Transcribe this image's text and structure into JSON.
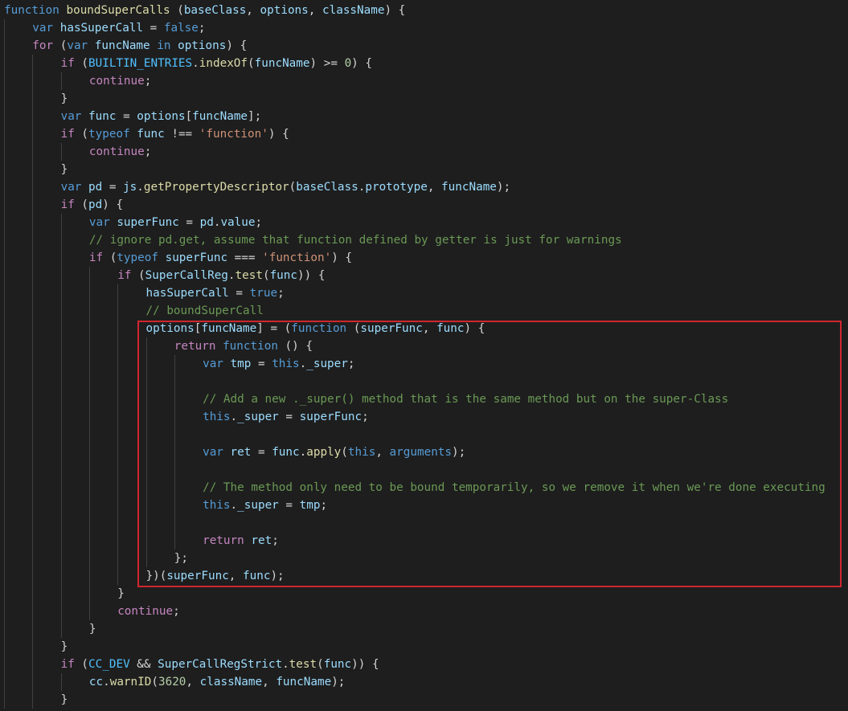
{
  "theme": {
    "background": "#1e1e1e",
    "highlight_border": "#d0262f",
    "token_colors": {
      "keyword": "#569cd6",
      "control": "#c586c0",
      "function": "#dcdcaa",
      "variable": "#9cdcfe",
      "string": "#ce9178",
      "comment": "#6a9955",
      "number": "#b5cea8",
      "constant": "#4fc1ff",
      "punct": "#d4d4d4"
    }
  },
  "code": {
    "highlighted_range": {
      "first_line": 19,
      "last_line": 33
    },
    "lines": [
      {
        "indent": 0,
        "tokens": [
          [
            "keyword",
            "function"
          ],
          [
            "punct",
            " "
          ],
          [
            "function",
            "boundSuperCalls"
          ],
          [
            "punct",
            " ("
          ],
          [
            "variable",
            "baseClass"
          ],
          [
            "punct",
            ", "
          ],
          [
            "variable",
            "options"
          ],
          [
            "punct",
            ", "
          ],
          [
            "variable",
            "className"
          ],
          [
            "punct",
            ") {"
          ]
        ]
      },
      {
        "indent": 1,
        "tokens": [
          [
            "keyword",
            "var"
          ],
          [
            "punct",
            " "
          ],
          [
            "variable",
            "hasSuperCall"
          ],
          [
            "punct",
            " = "
          ],
          [
            "keyword",
            "false"
          ],
          [
            "punct",
            ";"
          ]
        ]
      },
      {
        "indent": 1,
        "tokens": [
          [
            "control",
            "for"
          ],
          [
            "punct",
            " ("
          ],
          [
            "keyword",
            "var"
          ],
          [
            "punct",
            " "
          ],
          [
            "variable",
            "funcName"
          ],
          [
            "punct",
            " "
          ],
          [
            "keyword",
            "in"
          ],
          [
            "punct",
            " "
          ],
          [
            "variable",
            "options"
          ],
          [
            "punct",
            ") {"
          ]
        ]
      },
      {
        "indent": 2,
        "tokens": [
          [
            "control",
            "if"
          ],
          [
            "punct",
            " ("
          ],
          [
            "constant",
            "BUILTIN_ENTRIES"
          ],
          [
            "punct",
            "."
          ],
          [
            "function",
            "indexOf"
          ],
          [
            "punct",
            "("
          ],
          [
            "variable",
            "funcName"
          ],
          [
            "punct",
            ") >= "
          ],
          [
            "number",
            "0"
          ],
          [
            "punct",
            ") {"
          ]
        ]
      },
      {
        "indent": 3,
        "tokens": [
          [
            "control",
            "continue"
          ],
          [
            "punct",
            ";"
          ]
        ]
      },
      {
        "indent": 2,
        "tokens": [
          [
            "punct",
            "}"
          ]
        ]
      },
      {
        "indent": 2,
        "tokens": [
          [
            "keyword",
            "var"
          ],
          [
            "punct",
            " "
          ],
          [
            "variable",
            "func"
          ],
          [
            "punct",
            " = "
          ],
          [
            "variable",
            "options"
          ],
          [
            "punct",
            "["
          ],
          [
            "variable",
            "funcName"
          ],
          [
            "punct",
            "];"
          ]
        ]
      },
      {
        "indent": 2,
        "tokens": [
          [
            "control",
            "if"
          ],
          [
            "punct",
            " ("
          ],
          [
            "keyword",
            "typeof"
          ],
          [
            "punct",
            " "
          ],
          [
            "variable",
            "func"
          ],
          [
            "punct",
            " !== "
          ],
          [
            "string",
            "'function'"
          ],
          [
            "punct",
            ") {"
          ]
        ]
      },
      {
        "indent": 3,
        "tokens": [
          [
            "control",
            "continue"
          ],
          [
            "punct",
            ";"
          ]
        ]
      },
      {
        "indent": 2,
        "tokens": [
          [
            "punct",
            "}"
          ]
        ]
      },
      {
        "indent": 2,
        "tokens": [
          [
            "keyword",
            "var"
          ],
          [
            "punct",
            " "
          ],
          [
            "variable",
            "pd"
          ],
          [
            "punct",
            " = "
          ],
          [
            "variable",
            "js"
          ],
          [
            "punct",
            "."
          ],
          [
            "function",
            "getPropertyDescriptor"
          ],
          [
            "punct",
            "("
          ],
          [
            "variable",
            "baseClass"
          ],
          [
            "punct",
            "."
          ],
          [
            "variable",
            "prototype"
          ],
          [
            "punct",
            ", "
          ],
          [
            "variable",
            "funcName"
          ],
          [
            "punct",
            ");"
          ]
        ]
      },
      {
        "indent": 2,
        "tokens": [
          [
            "control",
            "if"
          ],
          [
            "punct",
            " ("
          ],
          [
            "variable",
            "pd"
          ],
          [
            "punct",
            ") {"
          ]
        ]
      },
      {
        "indent": 3,
        "tokens": [
          [
            "keyword",
            "var"
          ],
          [
            "punct",
            " "
          ],
          [
            "variable",
            "superFunc"
          ],
          [
            "punct",
            " = "
          ],
          [
            "variable",
            "pd"
          ],
          [
            "punct",
            "."
          ],
          [
            "variable",
            "value"
          ],
          [
            "punct",
            ";"
          ]
        ]
      },
      {
        "indent": 3,
        "tokens": [
          [
            "comment",
            "// ignore pd.get, assume that function defined by getter is just for warnings"
          ]
        ]
      },
      {
        "indent": 3,
        "tokens": [
          [
            "control",
            "if"
          ],
          [
            "punct",
            " ("
          ],
          [
            "keyword",
            "typeof"
          ],
          [
            "punct",
            " "
          ],
          [
            "variable",
            "superFunc"
          ],
          [
            "punct",
            " === "
          ],
          [
            "string",
            "'function'"
          ],
          [
            "punct",
            ") {"
          ]
        ]
      },
      {
        "indent": 4,
        "tokens": [
          [
            "control",
            "if"
          ],
          [
            "punct",
            " ("
          ],
          [
            "variable",
            "SuperCallReg"
          ],
          [
            "punct",
            "."
          ],
          [
            "function",
            "test"
          ],
          [
            "punct",
            "("
          ],
          [
            "variable",
            "func"
          ],
          [
            "punct",
            ")) {"
          ]
        ]
      },
      {
        "indent": 5,
        "tokens": [
          [
            "variable",
            "hasSuperCall"
          ],
          [
            "punct",
            " = "
          ],
          [
            "keyword",
            "true"
          ],
          [
            "punct",
            ";"
          ]
        ]
      },
      {
        "indent": 5,
        "tokens": [
          [
            "comment",
            "// boundSuperCall"
          ]
        ]
      },
      {
        "indent": 5,
        "tokens": [
          [
            "variable",
            "options"
          ],
          [
            "punct",
            "["
          ],
          [
            "variable",
            "funcName"
          ],
          [
            "punct",
            "] = ("
          ],
          [
            "keyword",
            "function"
          ],
          [
            "punct",
            " ("
          ],
          [
            "variable",
            "superFunc"
          ],
          [
            "punct",
            ", "
          ],
          [
            "variable",
            "func"
          ],
          [
            "punct",
            ") {"
          ]
        ]
      },
      {
        "indent": 6,
        "tokens": [
          [
            "control",
            "return"
          ],
          [
            "punct",
            " "
          ],
          [
            "keyword",
            "function"
          ],
          [
            "punct",
            " () {"
          ]
        ]
      },
      {
        "indent": 7,
        "tokens": [
          [
            "keyword",
            "var"
          ],
          [
            "punct",
            " "
          ],
          [
            "variable",
            "tmp"
          ],
          [
            "punct",
            " = "
          ],
          [
            "keyword",
            "this"
          ],
          [
            "punct",
            "."
          ],
          [
            "variable",
            "_super"
          ],
          [
            "punct",
            ";"
          ]
        ]
      },
      {
        "indent": 7,
        "tokens": []
      },
      {
        "indent": 7,
        "tokens": [
          [
            "comment",
            "// Add a new ._super() method that is the same method but on the super-Class"
          ]
        ]
      },
      {
        "indent": 7,
        "tokens": [
          [
            "keyword",
            "this"
          ],
          [
            "punct",
            "."
          ],
          [
            "variable",
            "_super"
          ],
          [
            "punct",
            " = "
          ],
          [
            "variable",
            "superFunc"
          ],
          [
            "punct",
            ";"
          ]
        ]
      },
      {
        "indent": 7,
        "tokens": []
      },
      {
        "indent": 7,
        "tokens": [
          [
            "keyword",
            "var"
          ],
          [
            "punct",
            " "
          ],
          [
            "variable",
            "ret"
          ],
          [
            "punct",
            " = "
          ],
          [
            "variable",
            "func"
          ],
          [
            "punct",
            "."
          ],
          [
            "function",
            "apply"
          ],
          [
            "punct",
            "("
          ],
          [
            "keyword",
            "this"
          ],
          [
            "punct",
            ", "
          ],
          [
            "keyword",
            "arguments"
          ],
          [
            "punct",
            ");"
          ]
        ]
      },
      {
        "indent": 7,
        "tokens": []
      },
      {
        "indent": 7,
        "tokens": [
          [
            "comment",
            "// The method only need to be bound temporarily, so we remove it when we're done executing"
          ]
        ]
      },
      {
        "indent": 7,
        "tokens": [
          [
            "keyword",
            "this"
          ],
          [
            "punct",
            "."
          ],
          [
            "variable",
            "_super"
          ],
          [
            "punct",
            " = "
          ],
          [
            "variable",
            "tmp"
          ],
          [
            "punct",
            ";"
          ]
        ]
      },
      {
        "indent": 7,
        "tokens": []
      },
      {
        "indent": 7,
        "tokens": [
          [
            "control",
            "return"
          ],
          [
            "punct",
            " "
          ],
          [
            "variable",
            "ret"
          ],
          [
            "punct",
            ";"
          ]
        ]
      },
      {
        "indent": 6,
        "tokens": [
          [
            "punct",
            "};"
          ]
        ]
      },
      {
        "indent": 5,
        "tokens": [
          [
            "punct",
            "})("
          ],
          [
            "variable",
            "superFunc"
          ],
          [
            "punct",
            ", "
          ],
          [
            "variable",
            "func"
          ],
          [
            "punct",
            ");"
          ]
        ]
      },
      {
        "indent": 4,
        "tokens": [
          [
            "punct",
            "}"
          ]
        ]
      },
      {
        "indent": 4,
        "tokens": [
          [
            "control",
            "continue"
          ],
          [
            "punct",
            ";"
          ]
        ]
      },
      {
        "indent": 3,
        "tokens": [
          [
            "punct",
            "}"
          ]
        ]
      },
      {
        "indent": 2,
        "tokens": [
          [
            "punct",
            "}"
          ]
        ]
      },
      {
        "indent": 2,
        "tokens": [
          [
            "control",
            "if"
          ],
          [
            "punct",
            " ("
          ],
          [
            "constant",
            "CC_DEV"
          ],
          [
            "punct",
            " && "
          ],
          [
            "variable",
            "SuperCallRegStrict"
          ],
          [
            "punct",
            "."
          ],
          [
            "function",
            "test"
          ],
          [
            "punct",
            "("
          ],
          [
            "variable",
            "func"
          ],
          [
            "punct",
            ")) {"
          ]
        ]
      },
      {
        "indent": 3,
        "tokens": [
          [
            "variable",
            "cc"
          ],
          [
            "punct",
            "."
          ],
          [
            "function",
            "warnID"
          ],
          [
            "punct",
            "("
          ],
          [
            "number",
            "3620"
          ],
          [
            "punct",
            ", "
          ],
          [
            "variable",
            "className"
          ],
          [
            "punct",
            ", "
          ],
          [
            "variable",
            "funcName"
          ],
          [
            "punct",
            ");"
          ]
        ]
      },
      {
        "indent": 2,
        "tokens": [
          [
            "punct",
            "}"
          ]
        ]
      }
    ]
  }
}
